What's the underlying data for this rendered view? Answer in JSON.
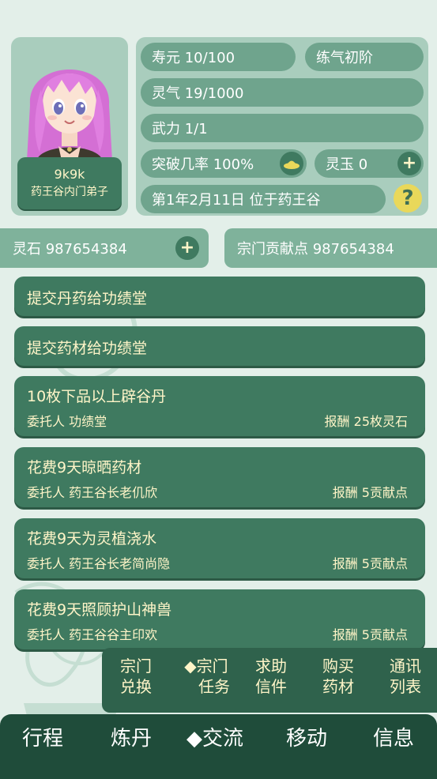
{
  "character": {
    "name": "9k9k",
    "rank": "药王谷内门弟子"
  },
  "stats": {
    "lifespan": "寿元 10/100",
    "realm": "练气初阶",
    "qi": "灵气 19/1000",
    "power": "武力 1/1",
    "breakthrough": "突破几率 100%",
    "jade": "灵玉 0",
    "date_location": "第1年2月11日 位于药王谷",
    "help": "?"
  },
  "resources": {
    "spirit_stones": "灵石 987654384",
    "sect_points": "宗门贡献点 987654384",
    "add": "+"
  },
  "tasks": [
    {
      "title": "提交丹药给功绩堂"
    },
    {
      "title": "提交药材给功绩堂"
    },
    {
      "title": "10枚下品以上辟谷丹",
      "client": "委托人 功绩堂",
      "reward": "报酬 25枚灵石"
    },
    {
      "title": "花费9天晾晒药材",
      "client": "委托人 药王谷长老仉欣",
      "reward": "报酬 5贡献点"
    },
    {
      "title": "花费9天为灵植浇水",
      "client": "委托人 药王谷长老简尚隐",
      "reward": "报酬 5贡献点"
    },
    {
      "title": "花费9天照顾护山神兽",
      "client": "委托人 药王谷谷主印欢",
      "reward": "报酬 5贡献点"
    }
  ],
  "sub_nav": [
    {
      "line1": "宗门",
      "line2": "兑换"
    },
    {
      "line1": "◆宗门",
      "line2": "任务"
    },
    {
      "line1": "求助",
      "line2": "信件"
    },
    {
      "line1": "购买",
      "line2": "药材"
    },
    {
      "line1": "通讯",
      "line2": "列表"
    }
  ],
  "bottom_nav": [
    "行程",
    "炼丹",
    "◆交流",
    "移动",
    "信息"
  ],
  "colors": {
    "background": "#e3efe9",
    "panel": "#a9cdbd",
    "pill": "#6fa48d",
    "dark_green": "#3f7a60",
    "nav": "#1f4c3a",
    "gold_text": "#fff5c8",
    "help_yellow": "#e9d85a"
  }
}
